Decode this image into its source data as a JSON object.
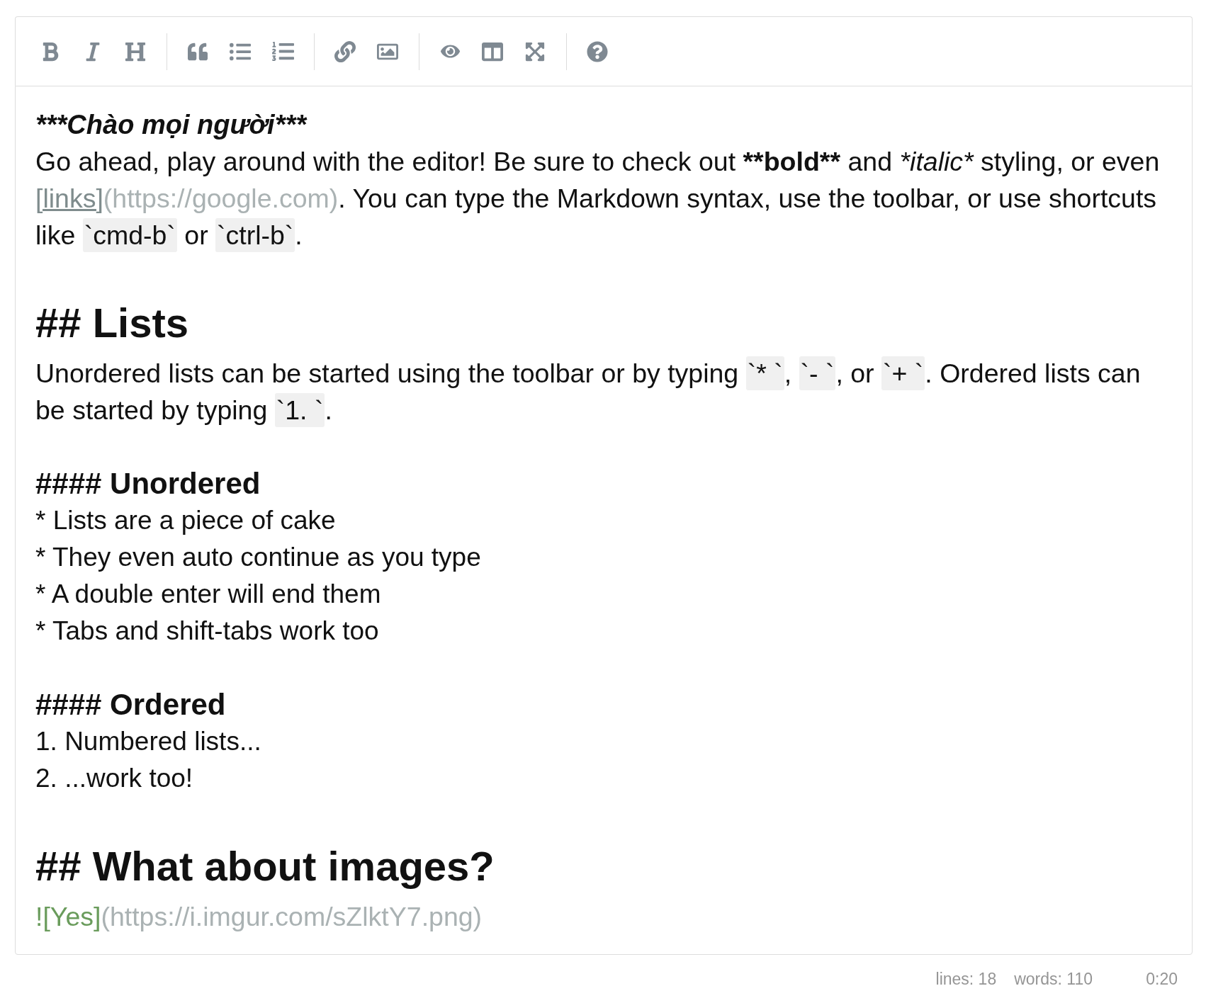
{
  "editor": {
    "blocks": [
      {
        "lines": [
          {
            "kind": "title",
            "text": "***Chào mọi người***"
          },
          {
            "kind": "paragraph",
            "segments": [
              {
                "kind": "plain",
                "text": "Go ahead, play around with the editor! Be sure to check out "
              },
              {
                "kind": "strong",
                "text": "**bold**"
              },
              {
                "kind": "plain",
                "text": " and "
              },
              {
                "kind": "em",
                "text": "*italic*"
              },
              {
                "kind": "plain",
                "text": " styling, or even "
              },
              {
                "kind": "link_text",
                "text": "[links]"
              },
              {
                "kind": "url",
                "text": "(https://google.com)"
              },
              {
                "kind": "plain",
                "text": ". You can type the Markdown syntax, use the toolbar, or use shortcuts like "
              },
              {
                "kind": "code",
                "text": "`cmd-b`"
              },
              {
                "kind": "plain",
                "text": " or "
              },
              {
                "kind": "code",
                "text": "`ctrl-b`"
              },
              {
                "kind": "plain",
                "text": "."
              }
            ]
          }
        ]
      },
      {
        "lines": [
          {
            "kind": "h2",
            "text": "## Lists"
          },
          {
            "kind": "paragraph",
            "segments": [
              {
                "kind": "plain",
                "text": "Unordered lists can be started using the toolbar or by typing "
              },
              {
                "kind": "code",
                "text": "`* `"
              },
              {
                "kind": "plain",
                "text": ", "
              },
              {
                "kind": "code",
                "text": "`- `"
              },
              {
                "kind": "plain",
                "text": ", or "
              },
              {
                "kind": "code",
                "text": "`+ `"
              },
              {
                "kind": "plain",
                "text": ". Ordered lists can be started by typing "
              },
              {
                "kind": "code",
                "text": "`1. `"
              },
              {
                "kind": "plain",
                "text": "."
              }
            ]
          }
        ]
      },
      {
        "lines": [
          {
            "kind": "h4",
            "text": "#### Unordered"
          },
          {
            "kind": "list_item",
            "text": "* Lists are a piece of cake"
          },
          {
            "kind": "list_item",
            "text": "* They even auto continue as you type"
          },
          {
            "kind": "list_item",
            "text": "* A double enter will end them"
          },
          {
            "kind": "list_item",
            "text": "* Tabs and shift-tabs work too"
          }
        ]
      },
      {
        "lines": [
          {
            "kind": "h4",
            "text": "#### Ordered"
          },
          {
            "kind": "list_item",
            "text": "1. Numbered lists..."
          },
          {
            "kind": "list_item",
            "text": "2. ...work too!"
          }
        ]
      },
      {
        "lines": [
          {
            "kind": "h2",
            "text": "## What about images?"
          },
          {
            "kind": "image_link",
            "segments": [
              {
                "kind": "image_alt",
                "text": "![Yes]"
              },
              {
                "kind": "url",
                "text": "(https://i.imgur.com/sZlktY7.png)"
              }
            ]
          }
        ]
      }
    ]
  },
  "status_bar": {
    "lines": "lines: 18",
    "words": "words: 110",
    "cursor": "0:20"
  }
}
